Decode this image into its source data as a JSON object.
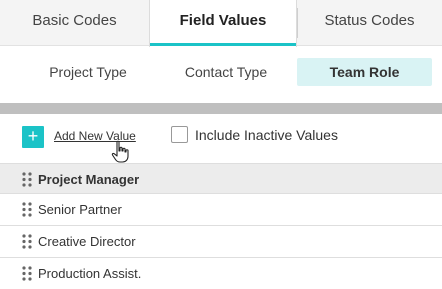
{
  "top_tabs": [
    {
      "label": "Basic Codes",
      "active": false
    },
    {
      "label": "Field Values",
      "active": true
    },
    {
      "label": "Status Codes",
      "active": false
    }
  ],
  "sub_tabs": [
    {
      "label": "Project Type",
      "active": false
    },
    {
      "label": "Contact Type",
      "active": false
    },
    {
      "label": "Team Role",
      "active": true
    }
  ],
  "toolbar": {
    "add_icon": "+",
    "add_label": "Add New Value",
    "include_inactive_label": "Include Inactive Values",
    "include_inactive_checked": false
  },
  "list": {
    "header": "Project Manager",
    "rows": [
      "Senior Partner",
      "Creative Director",
      "Production Assist."
    ]
  },
  "colors": {
    "accent": "#1bc3c7",
    "active_subtab_bg": "#d9f3f4"
  }
}
